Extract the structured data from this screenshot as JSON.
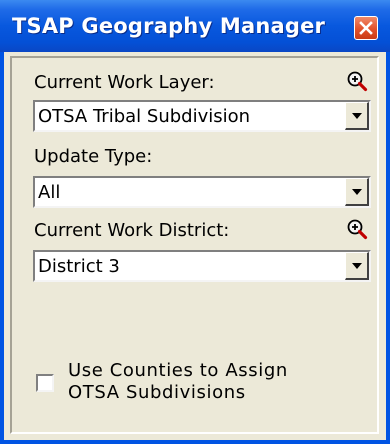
{
  "window": {
    "title": "TSAP Geography Manager"
  },
  "icons": {
    "close": "close-icon",
    "zoom": "zoom-in-icon",
    "dropdown": "chevron-down-icon"
  },
  "colors": {
    "titlebar": "#0054e3",
    "close_button": "#e2512a",
    "window_background": "#ece9d8"
  },
  "work_layer": {
    "label": "Current Work Layer:",
    "value": "OTSA Tribal Subdivision"
  },
  "update_type": {
    "label": "Update Type:",
    "value": "All"
  },
  "work_district": {
    "label": "Current Work District:",
    "value": "District 3"
  },
  "counties_option": {
    "line1": "Use Counties to Assign",
    "line2": "OTSA Subdivisions",
    "checked": false
  }
}
